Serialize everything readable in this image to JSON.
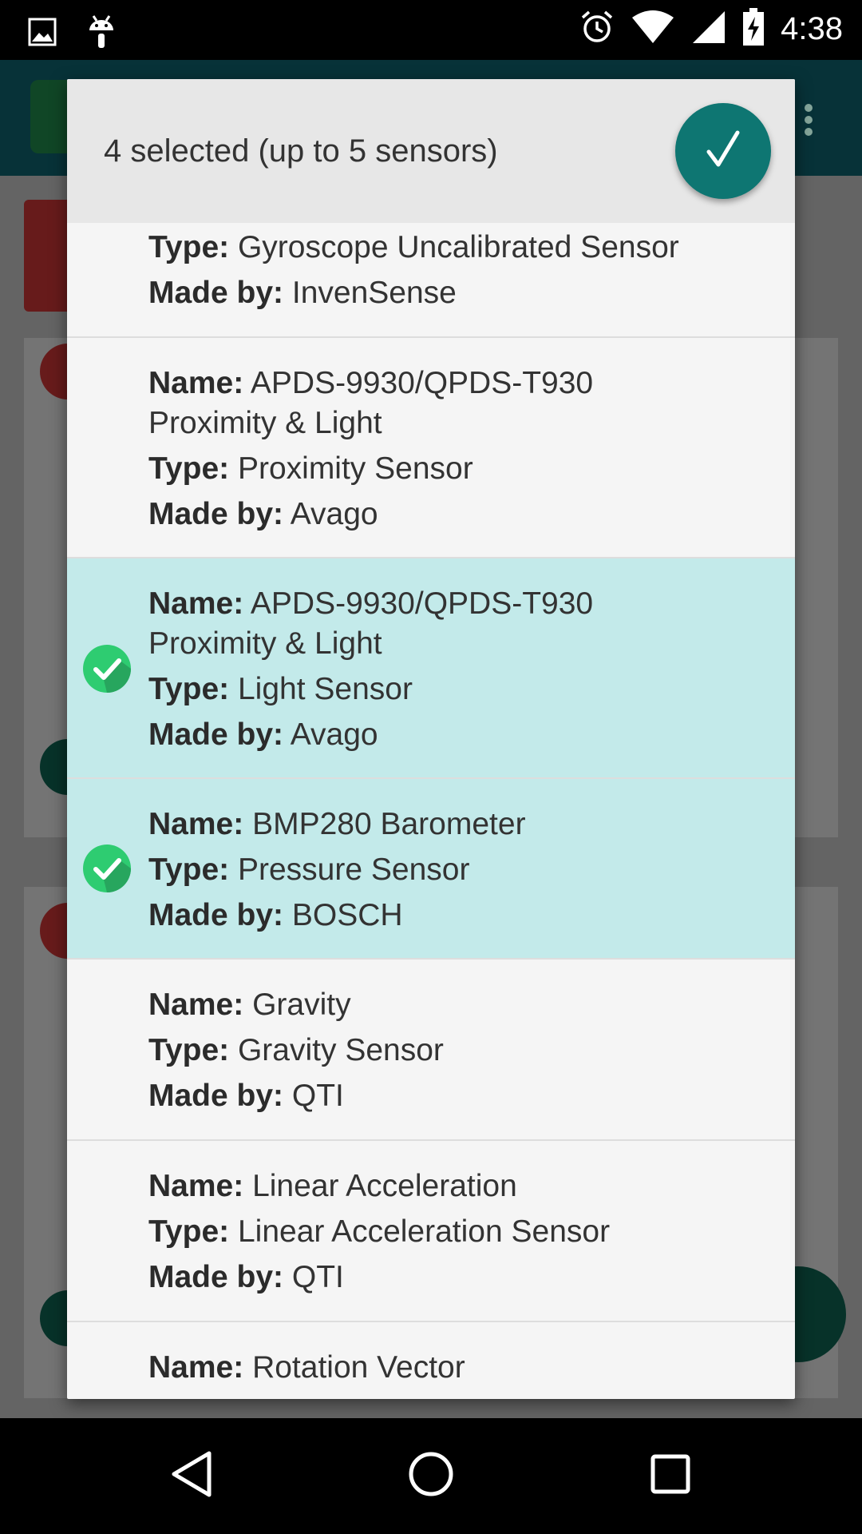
{
  "status_bar": {
    "time": "4:38",
    "left_icons": [
      "image-icon",
      "android-icon"
    ],
    "right_icons": [
      "alarm-icon",
      "wifi-icon",
      "signal-icon",
      "battery-charging-icon"
    ]
  },
  "dialog": {
    "title": "4 selected (up to 5 sensors)",
    "confirm_icon": "checkmark-icon",
    "accent_color": "#0e7672",
    "selected_color": "#c3eaea",
    "items": [
      {
        "name": "",
        "type": "Gyroscope Uncalibrated Sensor",
        "maker": "InvenSense",
        "selected": false
      },
      {
        "name": "APDS-9930/QPDS-T930",
        "name_line2": "Proximity & Light",
        "type": "Proximity Sensor",
        "maker": "Avago",
        "selected": false
      },
      {
        "name": "APDS-9930/QPDS-T930",
        "name_line2": "Proximity & Light",
        "type": "Light Sensor",
        "maker": "Avago",
        "selected": true
      },
      {
        "name": "BMP280 Barometer",
        "type": "Pressure Sensor",
        "maker": "BOSCH",
        "selected": true
      },
      {
        "name": "Gravity",
        "type": "Gravity Sensor",
        "maker": "QTI",
        "selected": false
      },
      {
        "name": "Linear Acceleration",
        "type": "Linear Acceleration Sensor",
        "maker": "QTI",
        "selected": false
      },
      {
        "name": "Rotation Vector",
        "selected": false
      }
    ]
  },
  "labels": {
    "name": "Name:",
    "type": "Type:",
    "maker": "Made by:"
  },
  "navbar": {
    "buttons": [
      "back-icon",
      "home-icon",
      "recents-icon"
    ]
  }
}
